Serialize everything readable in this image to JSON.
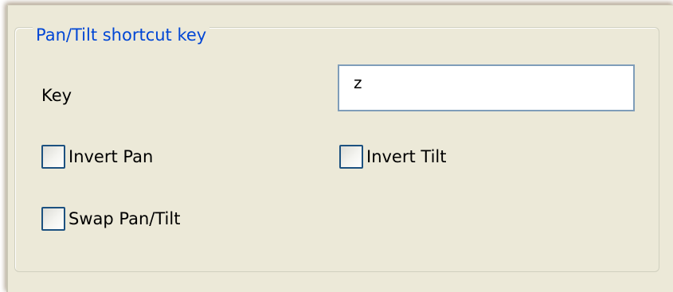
{
  "group": {
    "title": "Pan/Tilt shortcut key"
  },
  "key_field": {
    "label": "Key",
    "value": "z"
  },
  "checkboxes": [
    {
      "label": "Invert Pan",
      "checked": false
    },
    {
      "label": "Invert Tilt",
      "checked": false
    },
    {
      "label": "Swap Pan/Tilt",
      "checked": false
    }
  ],
  "colors": {
    "panel_background": "#ece9d8",
    "legend_text": "#0046d5",
    "input_border": "#7f9db9",
    "checkbox_border": "#1c5180"
  }
}
